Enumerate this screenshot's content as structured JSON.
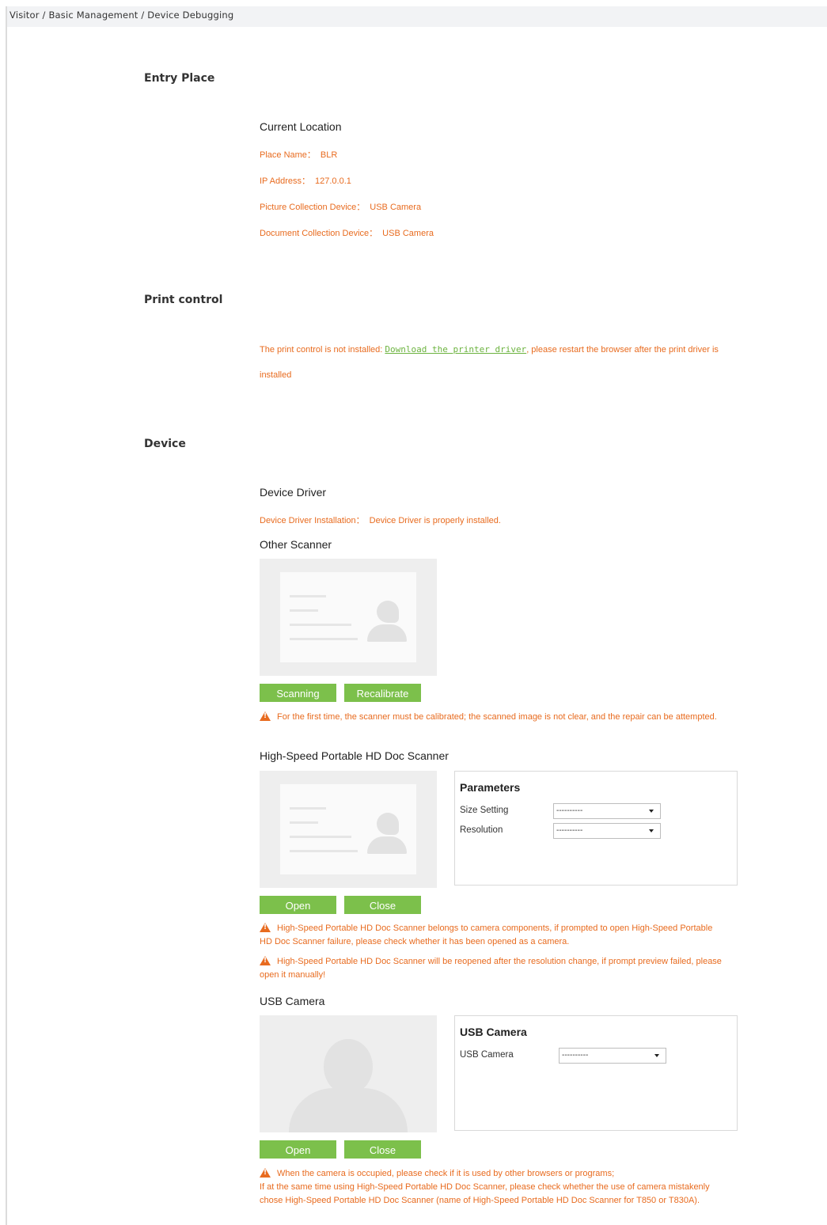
{
  "breadcrumb": "Visitor / Basic Management / Device Debugging",
  "entry_place": {
    "title": "Entry Place",
    "current_location": "Current Location",
    "rows": [
      {
        "label": "Place Name：",
        "value": "BLR"
      },
      {
        "label": "IP Address：",
        "value": "127.0.0.1"
      },
      {
        "label": "Picture Collection Device：",
        "value": "USB Camera"
      },
      {
        "label": "Document Collection Device：",
        "value": "USB Camera"
      }
    ]
  },
  "print_control": {
    "title": "Print control",
    "msg_before": "The print control is not installed:",
    "link": "Download the printer driver",
    "msg_after": ", please restart the browser after the print driver is",
    "msg_line2": "installed"
  },
  "device": {
    "title": "Device",
    "driver_title": "Device Driver",
    "driver_label": "Device Driver Installation：",
    "driver_value": "Device Driver is properly installed.",
    "other_scanner": {
      "title": "Other Scanner",
      "scan_button": "Scanning",
      "recalibrate_button": "Recalibrate",
      "warning": "For the first time, the scanner must be calibrated; the scanned image is not clear, and the repair can be attempted."
    },
    "hd_scanner": {
      "title": "High-Speed Portable HD Doc Scanner",
      "params_title": "Parameters",
      "size_label": "Size Setting",
      "size_value": "----------",
      "resolution_label": "Resolution",
      "resolution_value": "----------",
      "open_button": "Open",
      "close_button": "Close",
      "warning1": "High-Speed Portable HD Doc Scanner belongs to camera components, if prompted to open High-Speed Portable HD Doc Scanner failure, please check whether it has been opened as a camera.",
      "warning2": "High-Speed Portable HD Doc Scanner will be reopened after the resolution change, if prompt preview failed, please open it manually!"
    },
    "usb_camera": {
      "title": "USB Camera",
      "params_title": "USB Camera",
      "camera_label": "USB Camera",
      "camera_value": "----------",
      "open_button": "Open",
      "close_button": "Close",
      "warning_line1": "When the camera is occupied, please check if it is used by other browsers or programs;",
      "warning_rest": "If at the same time using High-Speed Portable HD Doc Scanner, please check whether the use of camera mistakenly chose High-Speed Portable HD Doc Scanner (name of High-Speed Portable HD Doc Scanner for T850 or T830A)."
    }
  },
  "colors": {
    "accent_green": "#7cc04b",
    "warning_orange": "#e86b1f",
    "link_green": "#6cb33f",
    "breadcrumb_bg": "#f2f3f5"
  }
}
